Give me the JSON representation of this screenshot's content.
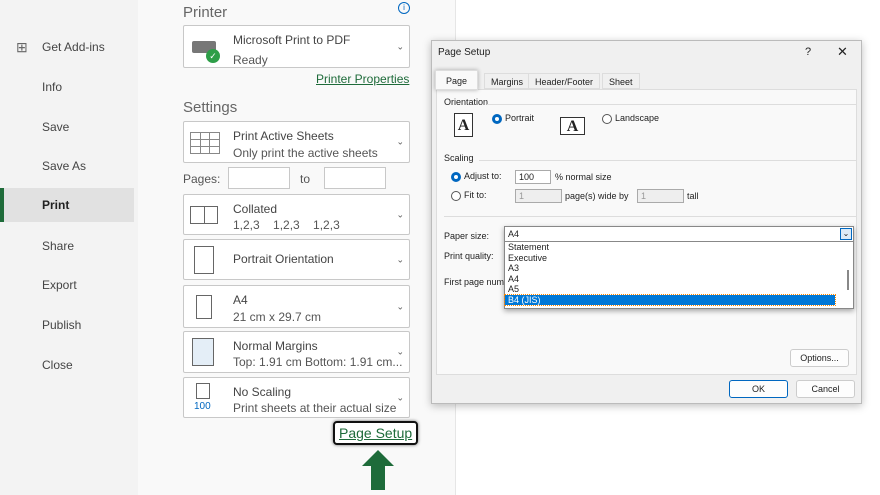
{
  "sidebar": {
    "items": [
      "Get Add-ins",
      "Info",
      "Save",
      "Save As",
      "Print",
      "Share",
      "Export",
      "Publish",
      "Close"
    ],
    "active": "Print"
  },
  "printer": {
    "heading": "Printer",
    "name": "Microsoft Print to PDF",
    "status": "Ready",
    "properties_link": "Printer Properties"
  },
  "settings": {
    "heading": "Settings",
    "what": {
      "title": "Print Active Sheets",
      "sub": "Only print the active sheets"
    },
    "pages_label": "Pages:",
    "to_label": "to",
    "collation": {
      "title": "Collated",
      "sub": "1,2,3    1,2,3    1,2,3"
    },
    "orientation": {
      "title": "Portrait Orientation"
    },
    "paper": {
      "title": "A4",
      "sub": "21 cm x 29.7 cm"
    },
    "margins": {
      "title": "Normal Margins",
      "sub": "Top: 1.91 cm Bottom: 1.91 cm..."
    },
    "scaling": {
      "title": "No Scaling",
      "sub": "Print sheets at their actual size",
      "icon_text": "100"
    },
    "page_setup_link": "Page Setup"
  },
  "dialog": {
    "title": "Page Setup",
    "help": "?",
    "close": "✕",
    "tabs": [
      "Page",
      "Margins",
      "Header/Footer",
      "Sheet"
    ],
    "orientation_label": "Orientation",
    "portrait": "Portrait",
    "landscape": "Landscape",
    "icon_letter": "A",
    "scaling_label": "Scaling",
    "adjust_to": "Adjust to:",
    "adjust_value": "100",
    "normal_size": "% normal size",
    "fit_to": "Fit to:",
    "fit_wide": "1",
    "wide_by": "page(s) wide by",
    "fit_tall": "1",
    "tall": "tall",
    "paper_size_label": "Paper size:",
    "paper_size_value": "A4",
    "print_quality_label": "Print quality:",
    "first_page_label": "First page num",
    "paper_options": [
      "Statement",
      "Executive",
      "A3",
      "A4",
      "A5",
      "B4 (JIS)"
    ],
    "selected_option": "B4 (JIS)",
    "options_button": "Options...",
    "ok": "OK",
    "cancel": "Cancel"
  }
}
